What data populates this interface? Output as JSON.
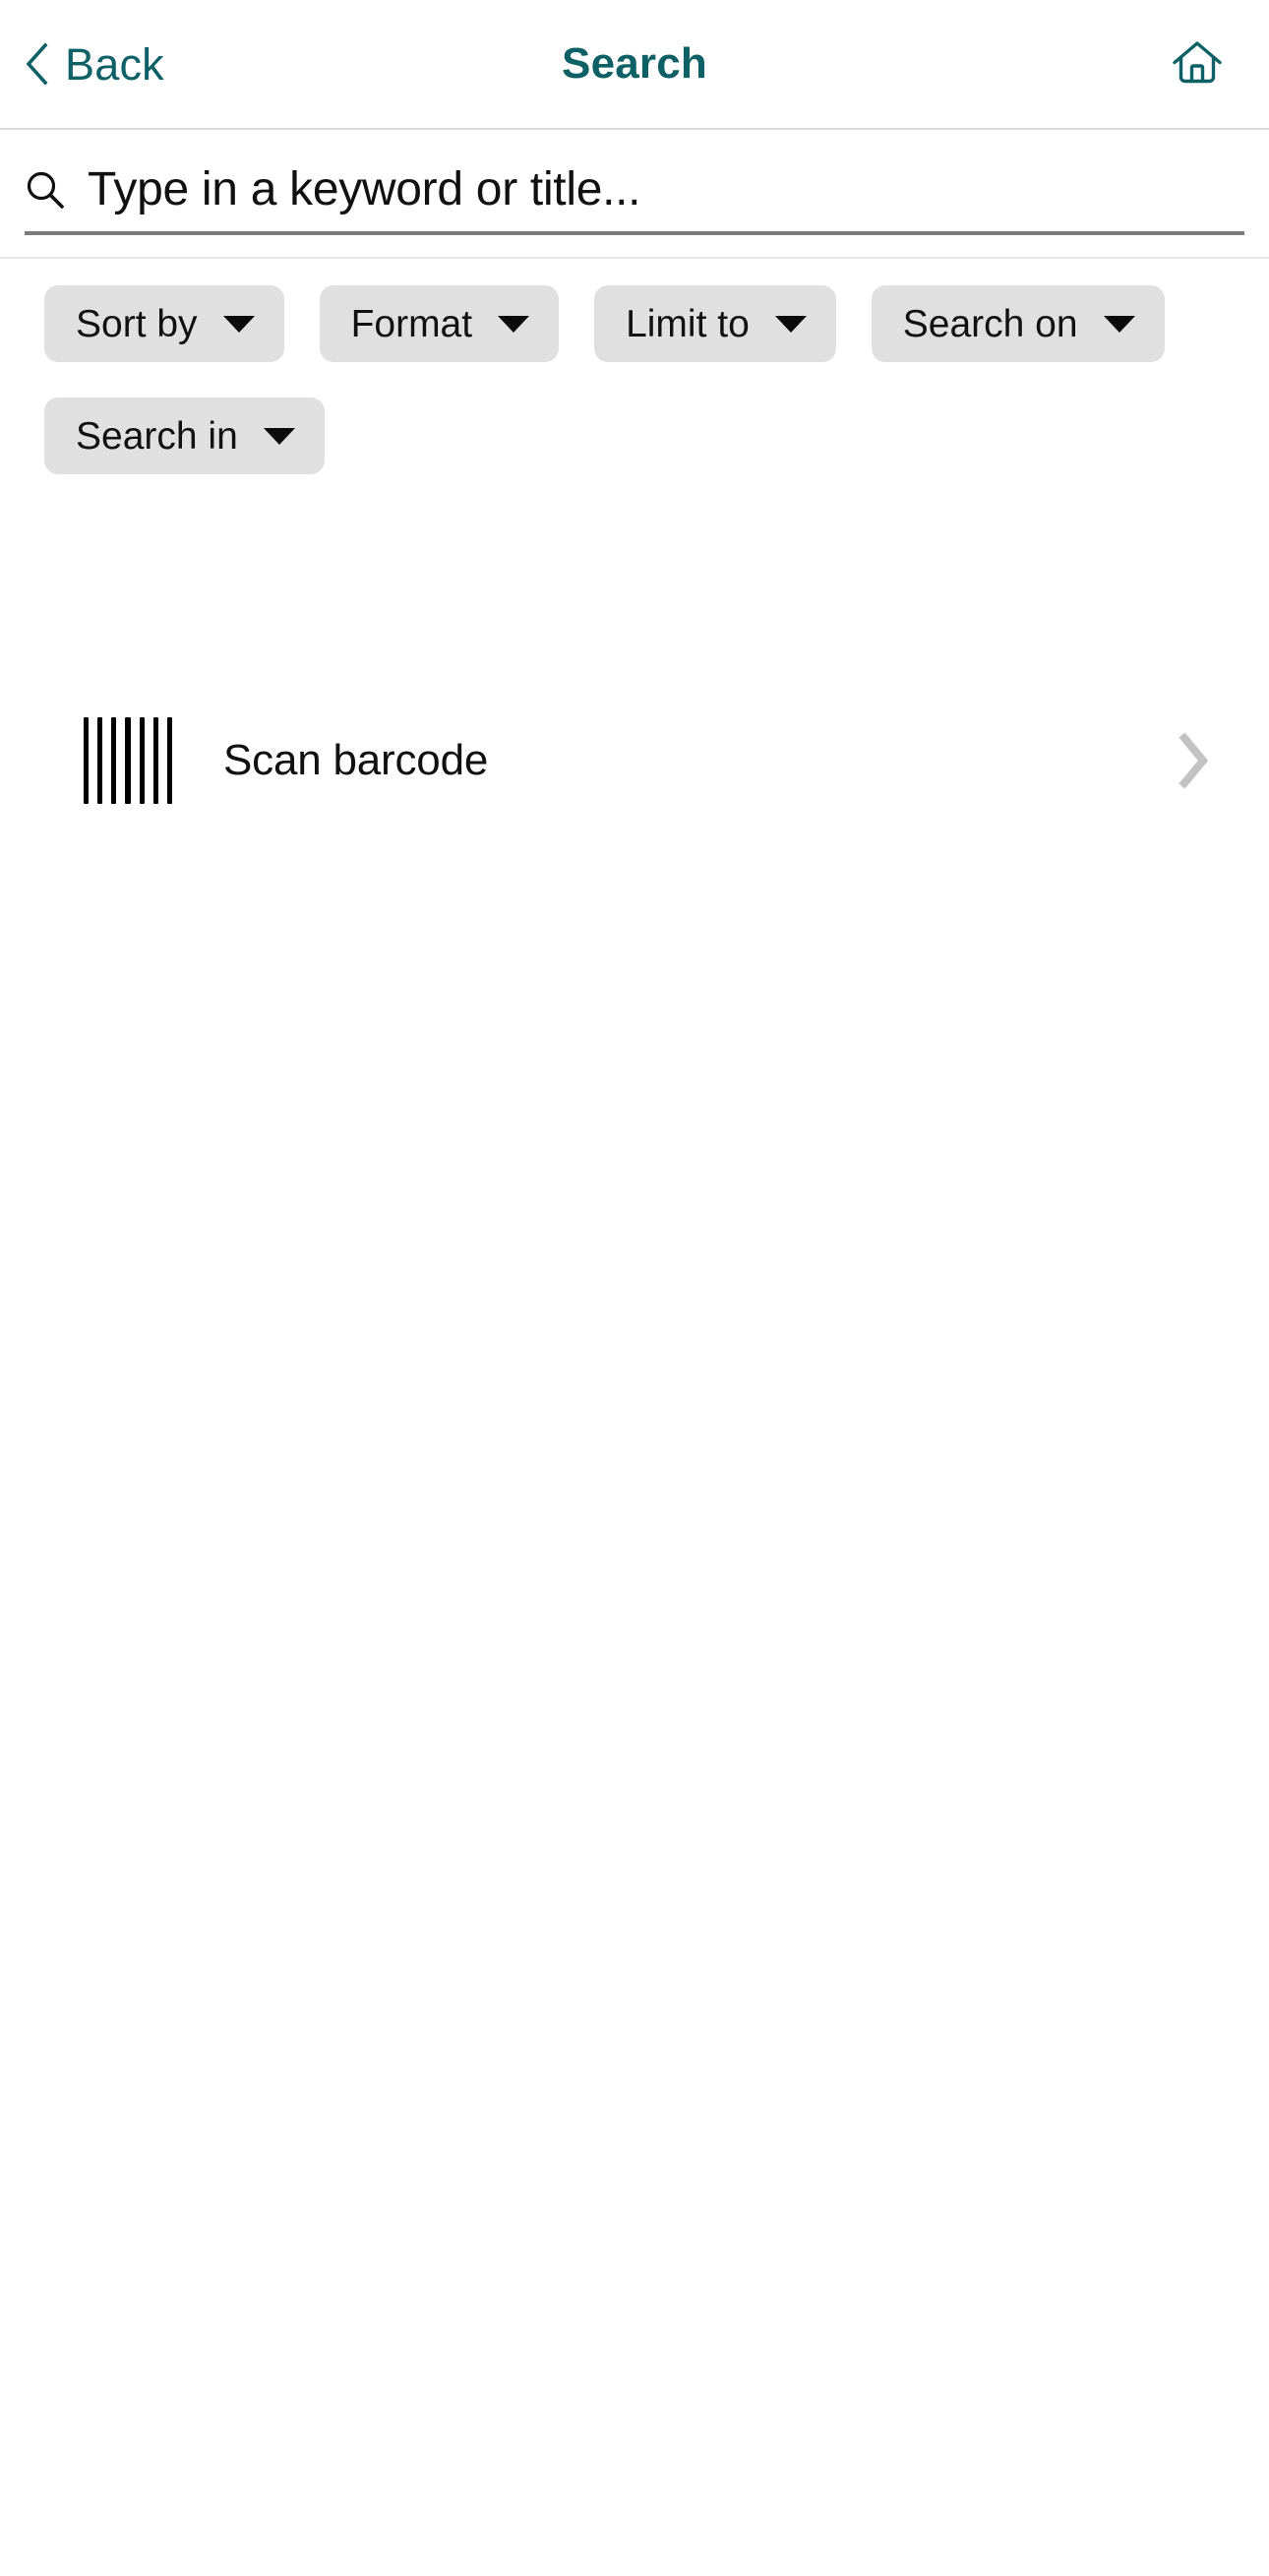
{
  "theme": {
    "accent": "#0d6166",
    "chip_bg": "#e0e0e0",
    "text": "#111111",
    "chevron_gray": "#c3c3c3",
    "underline": "#7b7b7b",
    "divider": "#dcdcdc"
  },
  "header": {
    "back_label": "Back",
    "back_icon": "chevron-left-icon",
    "title": "Search",
    "home_icon": "home-icon"
  },
  "search": {
    "icon": "search-icon",
    "value": "",
    "placeholder": "Type in a keyword or title..."
  },
  "filters": {
    "chips": [
      {
        "label": "Sort by",
        "icon": "chevron-down-icon"
      },
      {
        "label": "Format",
        "icon": "chevron-down-icon"
      },
      {
        "label": "Limit to",
        "icon": "chevron-down-icon"
      },
      {
        "label": "Search on",
        "icon": "chevron-down-icon"
      },
      {
        "label": "Search in",
        "icon": "chevron-down-icon"
      }
    ]
  },
  "actions": {
    "scan": {
      "icon": "barcode-icon",
      "label": "Scan barcode",
      "accessory_icon": "chevron-right-icon"
    }
  }
}
